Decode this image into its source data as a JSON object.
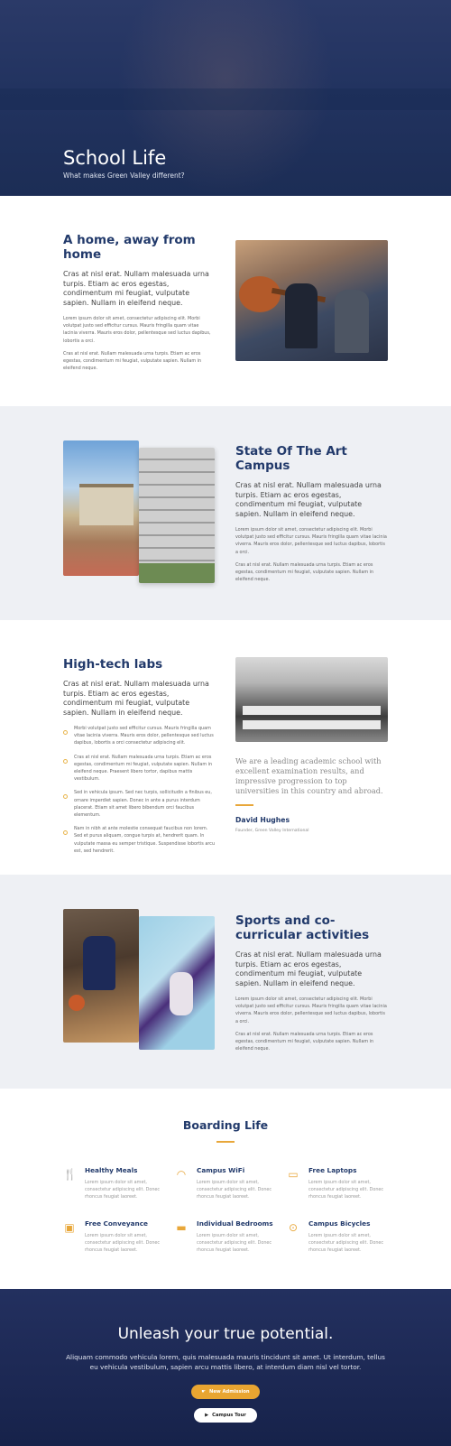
{
  "hero": {
    "title": "School Life",
    "subtitle": "What makes Green Valley different?"
  },
  "section_home": {
    "title": "A home, away from home",
    "lead": "Cras at nisl erat. Nullam malesuada urna turpis. Etiam ac eros egestas, condimentum mi feugiat, vulputate sapien. Nullam in eleifend neque.",
    "p1": "Lorem ipsum dolor sit amet, consectetur adipiscing elit. Morbi volutpat justo sed efficitur cursus. Mauris fringilla quam vitae lacinia viverra. Mauris eros dolor, pellentesque sed luctus dapibus, lobortis a orci.",
    "p2": "Cras at nisl erat. Nullam malesuada urna turpis. Etiam ac eros egestas, condimentum mi feugiat, vulputate sapien. Nullam in eleifend neque."
  },
  "section_campus": {
    "title": "State Of The Art Campus",
    "lead": "Cras at nisl erat. Nullam malesuada urna turpis. Etiam ac eros egestas, condimentum mi feugiat, vulputate sapien. Nullam in eleifend neque.",
    "p1": "Lorem ipsum dolor sit amet, consectetur adipiscing elit. Morbi volutpat justo sed efficitur cursus. Mauris fringilla quam vitae lacinia viverra. Mauris eros dolor, pellentesque sed luctus dapibus, lobortis a orci.",
    "p2": "Cras at nisl erat. Nullam malesuada urna turpis. Etiam ac eros egestas, condimentum mi feugiat, vulputate sapien. Nullam in eleifend neque."
  },
  "section_labs": {
    "title": "High-tech labs",
    "lead": "Cras at nisl erat. Nullam malesuada urna turpis. Etiam ac eros egestas, condimentum mi feugiat, vulputate sapien. Nullam in eleifend neque.",
    "bullets": [
      "Morbi volutpat justo sed efficitur cursus. Mauris fringilla quam vitae lacinia viverra. Mauris eros dolor, pellentesque sed luctus dapibus, lobortis a orci consectetur adipiscing elit.",
      "Cras at nisl erat. Nullam malesuada urna turpis. Etiam ac eros egestas, condimentum mi feugiat, vulputate sapien. Nullam in eleifend neque. Praesent libero tortor, dapibus mattis vestibulum.",
      "Sed in vehicula ipsum. Sed nec turpis, sollicitudin a finibus eu, ornare imperdiet sapien. Donec in ante a purus interdum placerat. Etiam sit amet libero bibendum orci faucibus elementum.",
      "Nam in nibh at ante molestie consequat faucibus non lorem. Sed et purus aliquam, congue turpis at, hendrerit quam. In vulputate massa eu semper tristique. Suspendisse lobortis arcu est, sed hendrerit."
    ],
    "quote": "We are a leading academic school with excellent examination results, and impressive progression to top universities in this country and abroad.",
    "quote_name": "David Hughes",
    "quote_role": "Founder, Green Valley International"
  },
  "section_sports": {
    "title": "Sports and co-curricular activities",
    "lead": "Cras at nisl erat. Nullam malesuada urna turpis. Etiam ac eros egestas, condimentum mi feugiat, vulputate sapien. Nullam in eleifend neque.",
    "p1": "Lorem ipsum dolor sit amet, consectetur adipiscing elit. Morbi volutpat justo sed efficitur cursus. Mauris fringilla quam vitae lacinia viverra. Mauris eros dolor, pellentesque sed luctus dapibus, lobortis a orci.",
    "p2": "Cras at nisl erat. Nullam malesuada urna turpis. Etiam ac eros egestas, condimentum mi feugiat, vulputate sapien. Nullam in eleifend neque."
  },
  "boarding": {
    "title": "Boarding Life",
    "features": [
      {
        "icon": "fork-knife-icon",
        "title": "Healthy Meals",
        "desc": "Lorem ipsum dolor sit amet, consectetur adipiscing elit. Donec rhoncus feugiat laoreet."
      },
      {
        "icon": "wifi-icon",
        "title": "Campus WiFi",
        "desc": "Lorem ipsum dolor sit amet, consectetur adipiscing elit. Donec rhoncus feugiat laoreet."
      },
      {
        "icon": "laptop-icon",
        "title": "Free Laptops",
        "desc": "Lorem ipsum dolor sit amet, consectetur adipiscing elit. Donec rhoncus feugiat laoreet."
      },
      {
        "icon": "bus-icon",
        "title": "Free Conveyance",
        "desc": "Lorem ipsum dolor sit amet, consectetur adipiscing elit. Donec rhoncus feugiat laoreet."
      },
      {
        "icon": "bed-icon",
        "title": "Individual Bedrooms",
        "desc": "Lorem ipsum dolor sit amet, consectetur adipiscing elit. Donec rhoncus feugiat laoreet."
      },
      {
        "icon": "bicycle-icon",
        "title": "Campus Bicycles",
        "desc": "Lorem ipsum dolor sit amet, consectetur adipiscing elit. Donec rhoncus feugiat laoreet."
      }
    ]
  },
  "cta": {
    "title": "Unleash your true potential.",
    "text": "Aliquam commodo vehicula lorem, quis malesuada mauris tincidunt sit amet. Ut interdum, tellus eu vehicula vestibulum, sapien arcu mattis libero, at interdum diam nisl vel tortor.",
    "admission_label": "New Admission",
    "tour_label": "Campus Tour"
  },
  "colors": {
    "navy": "#223a6b",
    "accent": "#e8a73a",
    "hero_bg": "#223360"
  }
}
